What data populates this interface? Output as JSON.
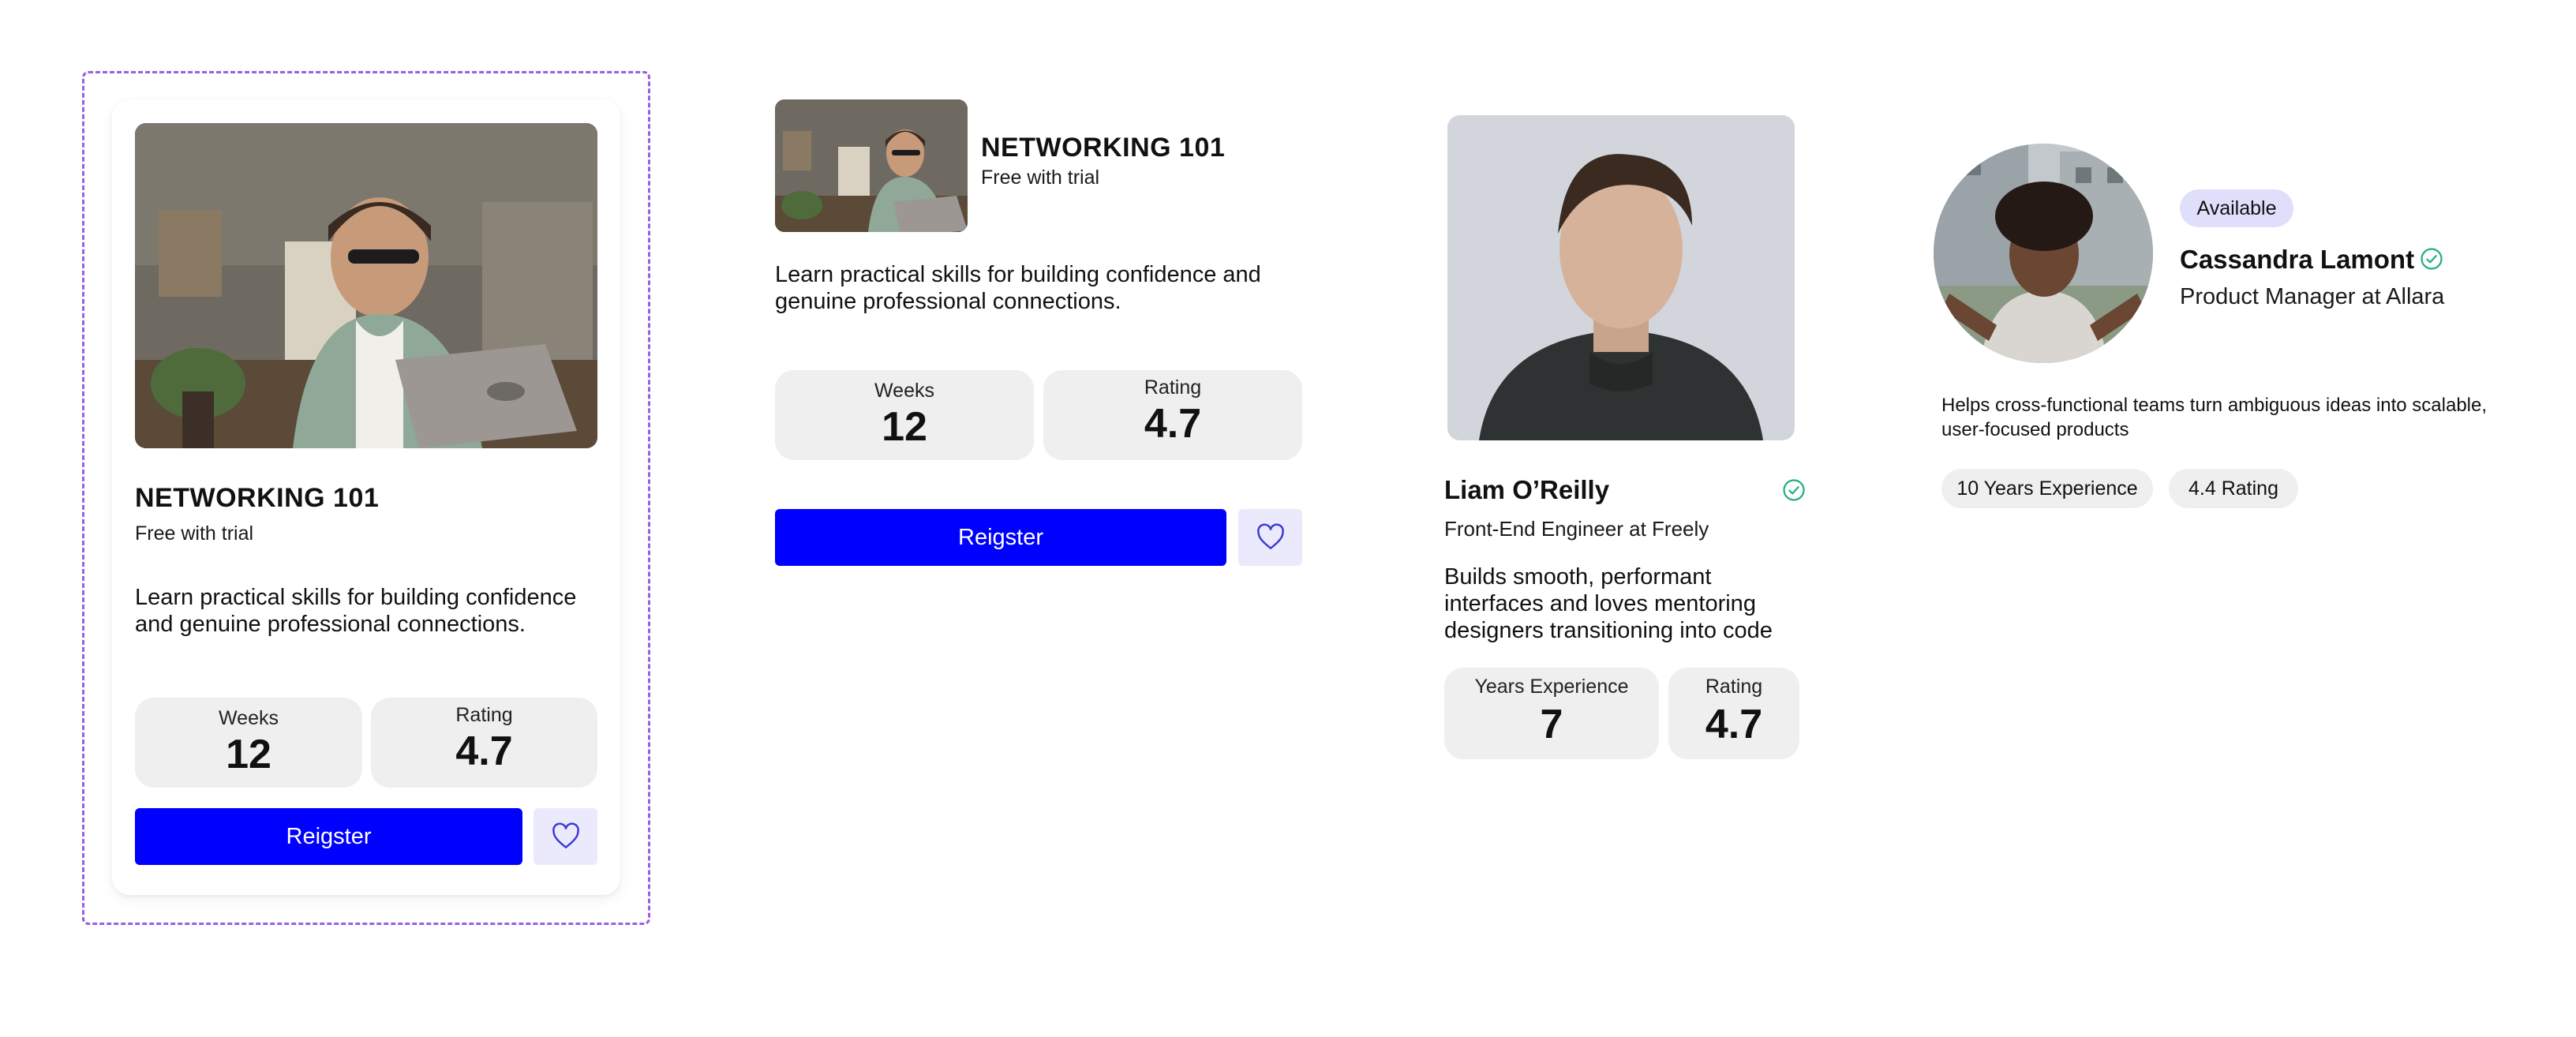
{
  "course_card": {
    "title": "NETWORKING 101",
    "subtitle": "Free with trial",
    "description": "Learn practical skills for building confidence and genuine professional connections.",
    "stats": [
      {
        "label": "Weeks",
        "value": "12"
      },
      {
        "label": "Rating",
        "value": "4.7"
      }
    ],
    "register_label": "Reigster",
    "favorite_icon": "heart-icon"
  },
  "course_card_horizontal": {
    "title": "NETWORKING 101",
    "subtitle": "Free with trial",
    "description": "Learn practical skills for building confidence and genuine professional connections.",
    "stats": [
      {
        "label": "Weeks",
        "value": "12"
      },
      {
        "label": "Rating",
        "value": "4.7"
      }
    ],
    "register_label": "Reigster",
    "favorite_icon": "heart-icon"
  },
  "profile_card": {
    "name": "Liam O’Reilly",
    "role": "Front-End Engineer at Freely",
    "bio": "Builds smooth, performant interfaces and loves mentoring designers transitioning into code",
    "stats": [
      {
        "label": "Years Experience",
        "value": "7"
      },
      {
        "label": "Rating",
        "value": "4.7"
      }
    ],
    "verified_icon": "verified-check-icon"
  },
  "profile_card_compact": {
    "status_badge": "Available",
    "name": "Cassandra Lamont",
    "role": "Product Manager at Allara",
    "bio": "Helps cross-functional teams turn ambiguous ideas into scalable, user-focused products",
    "tags": [
      "10 Years Experience",
      "4.4 Rating"
    ],
    "verified_icon": "verified-check-icon"
  },
  "colors": {
    "primary_button": "#0000ff",
    "heart_button_bg": "#ebeafc",
    "heart_stroke": "#3a3ad6",
    "stat_bg": "#efefef",
    "verified_green": "#22b07d",
    "badge_bg": "#e0dffb",
    "selection_frame": "#9b5de5"
  }
}
